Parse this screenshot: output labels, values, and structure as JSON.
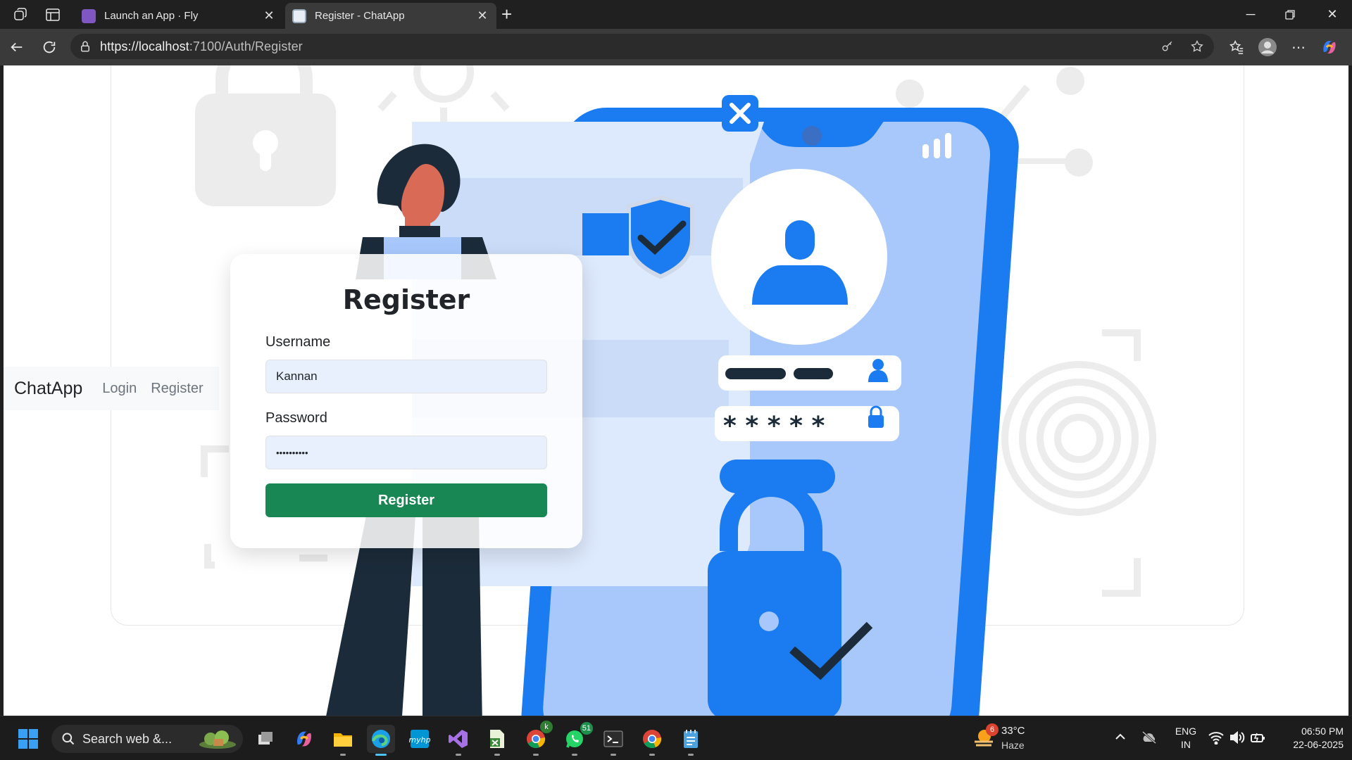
{
  "browser": {
    "tabs": [
      {
        "title": "Launch an App · Fly",
        "active": false
      },
      {
        "title": "Register - ChatApp",
        "active": true
      }
    ],
    "url_host": "https://localhost",
    "url_path": ":7100/Auth/Register"
  },
  "navbar": {
    "brand": "ChatApp",
    "links": [
      "Login",
      "Register"
    ]
  },
  "register_form": {
    "heading": "Register",
    "username_label": "Username",
    "username_value": "Kannan",
    "password_label": "Password",
    "password_value": "••••••••••",
    "submit_label": "Register"
  },
  "illustration": {
    "password_stars": "* * * * *",
    "accent_color": "#1a7cf0",
    "light_blue": "#a8c8fb"
  },
  "taskbar": {
    "search_placeholder": "Search web &...",
    "whatsapp_badge": "51",
    "weather_badge": "6",
    "weather_temp": "33°C",
    "weather_desc": "Haze",
    "lang_line1": "ENG",
    "lang_line2": "IN",
    "time": "06:50 PM",
    "date": "22-06-2025"
  }
}
